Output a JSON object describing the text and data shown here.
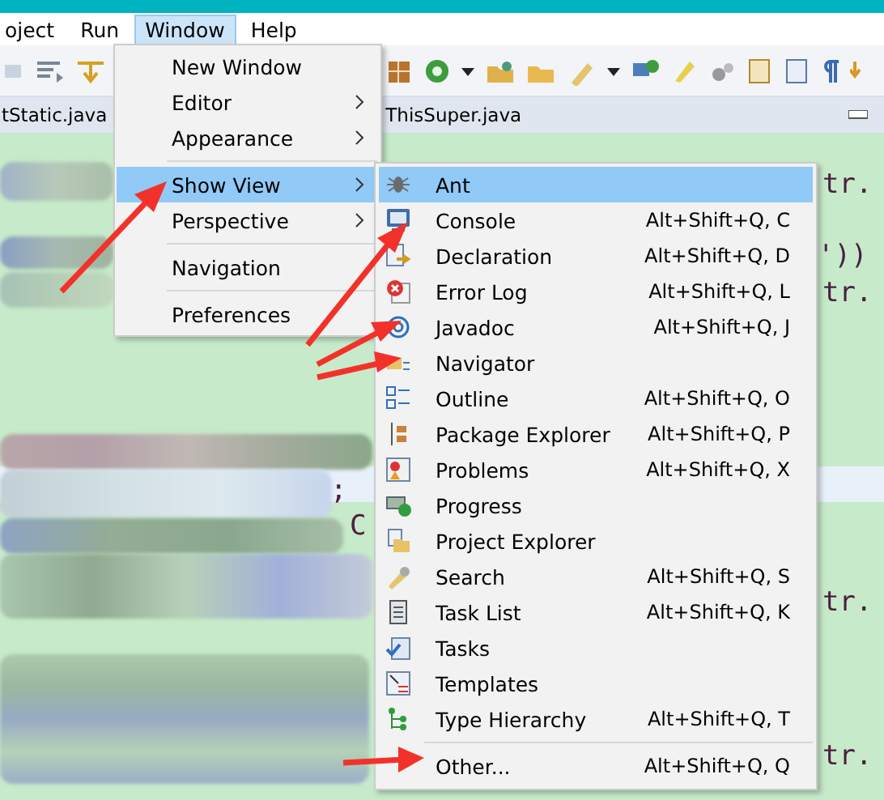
{
  "menu_bar": [
    {
      "label": "oject",
      "selected": false
    },
    {
      "label": "Run",
      "selected": false
    },
    {
      "label": "Window",
      "selected": true
    },
    {
      "label": "Help",
      "selected": false
    }
  ],
  "editor_tabs": [
    {
      "label": "tStatic.java"
    },
    {
      "label": "ThisSuper.java"
    }
  ],
  "code_fragments": [
    "tr.",
    "'))",
    "tr.",
    ";",
    "C",
    "tr.",
    "tr."
  ],
  "window_menu": [
    {
      "kind": "item",
      "label": "New Window",
      "selected": false
    },
    {
      "kind": "submenu",
      "label": "Editor",
      "selected": false
    },
    {
      "kind": "submenu",
      "label": "Appearance",
      "selected": false
    },
    {
      "kind": "separator"
    },
    {
      "kind": "submenu",
      "label": "Show View",
      "selected": true
    },
    {
      "kind": "submenu",
      "label": "Perspective",
      "selected": false
    },
    {
      "kind": "separator"
    },
    {
      "kind": "item",
      "label": "Navigation",
      "selected": false
    },
    {
      "kind": "separator"
    },
    {
      "kind": "item",
      "label": "Preferences",
      "selected": false
    }
  ],
  "show_view_menu": [
    {
      "kind": "item",
      "label": "Ant",
      "selected": true
    },
    {
      "kind": "item",
      "label": "Console",
      "shortcut": "Alt+Shift+Q, C",
      "selected": false
    },
    {
      "kind": "item",
      "label": "Declaration",
      "shortcut": "Alt+Shift+Q, D",
      "selected": false
    },
    {
      "kind": "item",
      "label": "Error Log",
      "shortcut": "Alt+Shift+Q, L",
      "selected": false
    },
    {
      "kind": "item",
      "label": "Javadoc",
      "shortcut": "Alt+Shift+Q, J",
      "selected": false
    },
    {
      "kind": "item",
      "label": "Navigator",
      "selected": false
    },
    {
      "kind": "item",
      "label": "Outline",
      "shortcut": "Alt+Shift+Q, O",
      "selected": false
    },
    {
      "kind": "item",
      "label": "Package Explorer",
      "shortcut": "Alt+Shift+Q, P",
      "selected": false
    },
    {
      "kind": "item",
      "label": "Problems",
      "shortcut": "Alt+Shift+Q, X",
      "selected": false
    },
    {
      "kind": "item",
      "label": "Progress",
      "selected": false
    },
    {
      "kind": "item",
      "label": "Project Explorer",
      "selected": false
    },
    {
      "kind": "item",
      "label": "Search",
      "shortcut": "Alt+Shift+Q, S",
      "selected": false
    },
    {
      "kind": "item",
      "label": "Task List",
      "shortcut": "Alt+Shift+Q, K",
      "selected": false
    },
    {
      "kind": "item",
      "label": "Tasks",
      "selected": false
    },
    {
      "kind": "item",
      "label": "Templates",
      "selected": false
    },
    {
      "kind": "item",
      "label": "Type Hierarchy",
      "shortcut": "Alt+Shift+Q, T",
      "selected": false
    },
    {
      "kind": "separator"
    },
    {
      "kind": "item",
      "label": "Other...",
      "shortcut": "Alt+Shift+Q, Q",
      "selected": false
    }
  ]
}
